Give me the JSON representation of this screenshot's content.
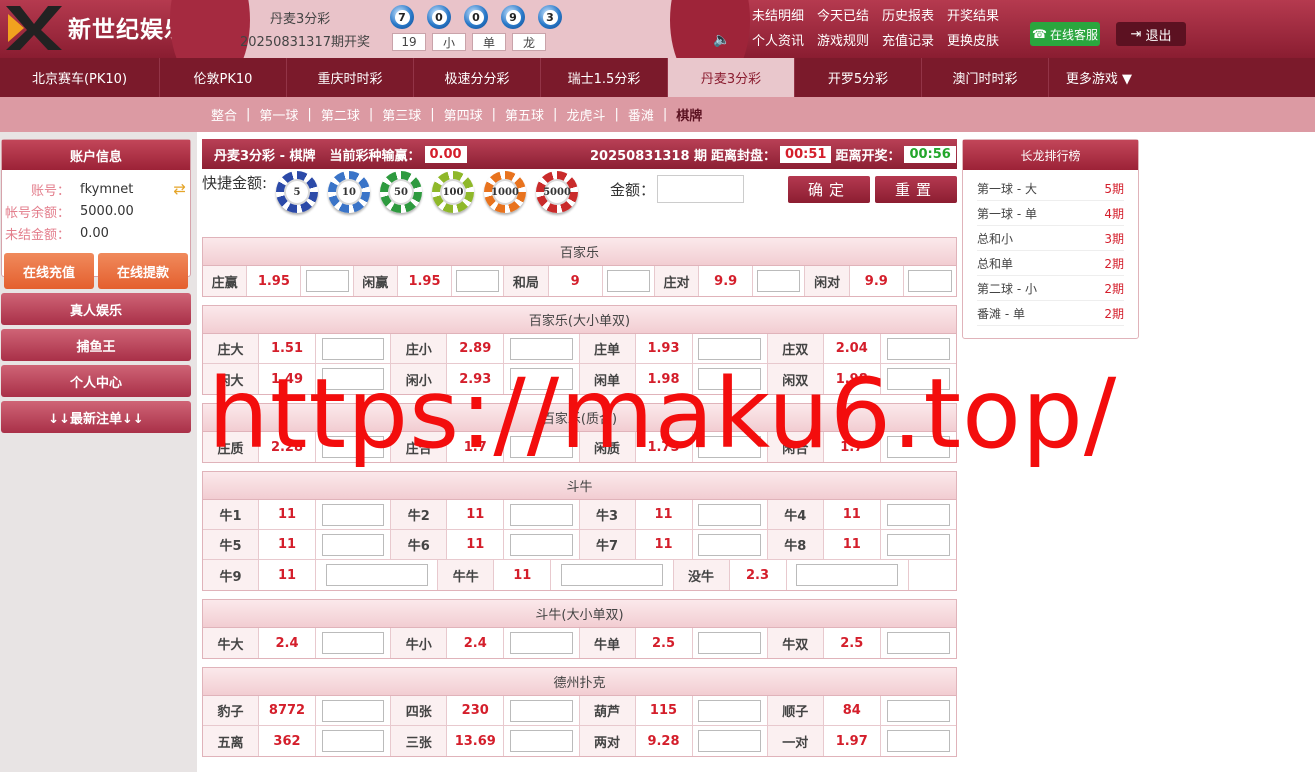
{
  "brand": {
    "logo_text": "新世纪娱乐城"
  },
  "header": {
    "lottery_name": "丹麦3分彩",
    "period_label": "20250831317期开奖",
    "balls": [
      "7",
      "0",
      "0",
      "9",
      "3"
    ],
    "results": [
      "19",
      "小",
      "单",
      "龙"
    ],
    "links": [
      "未结明细",
      "今天已结",
      "历史报表",
      "开奖结果",
      "个人资讯",
      "游戏规则",
      "充值记录",
      "更换皮肤"
    ],
    "customer_service": "在线客服",
    "logout": "退出"
  },
  "nav": {
    "items": [
      "北京赛车(PK10)",
      "伦敦PK10",
      "重庆时时彩",
      "极速分分彩",
      "瑞士1.5分彩",
      "丹麦3分彩",
      "开罗5分彩",
      "澳门时时彩"
    ],
    "active": "丹麦3分彩",
    "more": "更多游戏 ▼"
  },
  "subnav": {
    "items": [
      "整合",
      "第一球",
      "第二球",
      "第三球",
      "第四球",
      "第五球",
      "龙虎斗",
      "番滩",
      "棋牌"
    ],
    "active": "棋牌"
  },
  "account": {
    "title": "账户信息",
    "rows": [
      {
        "label": "账号：",
        "value": "fkymnet"
      },
      {
        "label": "帐号余额：",
        "value": "5000.00"
      },
      {
        "label": "未结金额：",
        "value": "0.00"
      }
    ],
    "recharge": "在线充值",
    "withdraw": "在线提款",
    "menu": [
      "真人娱乐",
      "捕鱼王",
      "个人中心",
      "↓↓最新注单↓↓"
    ]
  },
  "betbar": {
    "title": "丹麦3分彩 - 棋牌",
    "winloss_label": "当前彩种输赢：",
    "winloss": "0.00",
    "period": "20250831318 期",
    "close_label": "距离封盘：",
    "close_time": "00:51",
    "open_label": "距离开奖：",
    "open_time": "00:56"
  },
  "quick": {
    "label": "快捷金额:",
    "chips": [
      "5",
      "10",
      "50",
      "100",
      "1000",
      "5000"
    ],
    "chip_colors": [
      "#2c4aa8",
      "#3a74c8",
      "#2e9a3f",
      "#8fb82a",
      "#e8731e",
      "#c92b2b"
    ],
    "amount_label": "金额：",
    "confirm": "确定",
    "reset": "重置"
  },
  "sections": [
    {
      "title": "百家乐",
      "cols": 5,
      "rows": [
        [
          [
            "庄赢",
            "1.95"
          ],
          [
            "闲赢",
            "1.95"
          ],
          [
            "和局",
            "9"
          ],
          [
            "庄对",
            "9.9"
          ],
          [
            "闲对",
            "9.9"
          ]
        ]
      ]
    },
    {
      "title": "百家乐(大小单双)",
      "cols": 4,
      "rows": [
        [
          [
            "庄大",
            "1.51"
          ],
          [
            "庄小",
            "2.89"
          ],
          [
            "庄单",
            "1.93"
          ],
          [
            "庄双",
            "2.04"
          ]
        ],
        [
          [
            "闲大",
            "1.49"
          ],
          [
            "闲小",
            "2.93"
          ],
          [
            "闲单",
            "1.98"
          ],
          [
            "闲双",
            "1.98"
          ]
        ]
      ]
    },
    {
      "title": "百家乐(质合)",
      "cols": 4,
      "rows": [
        [
          [
            "庄质",
            "2.28"
          ],
          [
            "庄合",
            "1.7"
          ],
          [
            "闲质",
            "1.75"
          ],
          [
            "闲合",
            "1.7"
          ]
        ]
      ]
    },
    {
      "title": "斗牛",
      "cols": 4,
      "rows": [
        [
          [
            "牛1",
            "11"
          ],
          [
            "牛2",
            "11"
          ],
          [
            "牛3",
            "11"
          ],
          [
            "牛4",
            "11"
          ]
        ],
        [
          [
            "牛5",
            "11"
          ],
          [
            "牛6",
            "11"
          ],
          [
            "牛7",
            "11"
          ],
          [
            "牛8",
            "11"
          ]
        ],
        [
          [
            "牛9",
            "11"
          ],
          [
            "牛牛",
            "11"
          ],
          [
            "没牛",
            "2.3"
          ]
        ]
      ]
    },
    {
      "title": "斗牛(大小单双)",
      "cols": 4,
      "rows": [
        [
          [
            "牛大",
            "2.4"
          ],
          [
            "牛小",
            "2.4"
          ],
          [
            "牛单",
            "2.5"
          ],
          [
            "牛双",
            "2.5"
          ]
        ]
      ]
    },
    {
      "title": "德州扑克",
      "cols": 4,
      "rows": [
        [
          [
            "豹子",
            "8772"
          ],
          [
            "四张",
            "230"
          ],
          [
            "葫芦",
            "115"
          ],
          [
            "顺子",
            "84"
          ]
        ],
        [
          [
            "五离",
            "362"
          ],
          [
            "三张",
            "13.69"
          ],
          [
            "两对",
            "9.28"
          ],
          [
            "一对",
            "1.97"
          ]
        ]
      ]
    }
  ],
  "ranking": {
    "title": "长龙排行榜",
    "rows": [
      {
        "name": "第一球 - 大",
        "count": "5期"
      },
      {
        "name": "第一球 - 单",
        "count": "4期"
      },
      {
        "name": "总和小",
        "count": "3期"
      },
      {
        "name": "总和单",
        "count": "2期"
      },
      {
        "name": "第二球 - 小",
        "count": "2期"
      },
      {
        "name": "番滩 - 单",
        "count": "2期"
      }
    ]
  },
  "watermark": "https://maku6.top/"
}
